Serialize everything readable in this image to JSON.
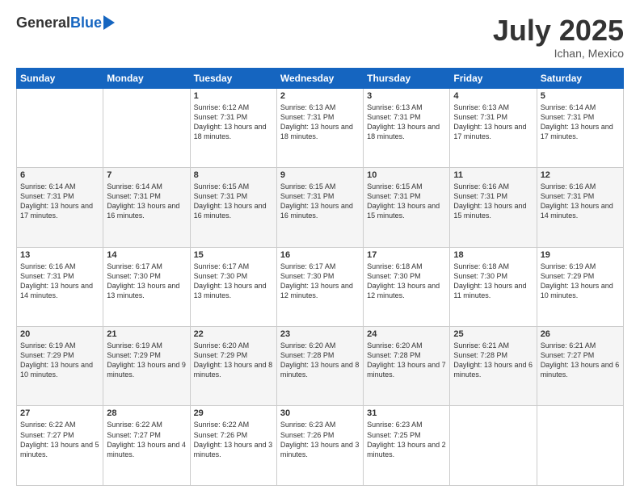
{
  "header": {
    "logo_general": "General",
    "logo_blue": "Blue",
    "title": "July 2025",
    "subtitle": "Ichan, Mexico"
  },
  "days_of_week": [
    "Sunday",
    "Monday",
    "Tuesday",
    "Wednesday",
    "Thursday",
    "Friday",
    "Saturday"
  ],
  "weeks": [
    [
      {
        "day": "",
        "info": ""
      },
      {
        "day": "",
        "info": ""
      },
      {
        "day": "1",
        "info": "Sunrise: 6:12 AM\nSunset: 7:31 PM\nDaylight: 13 hours and 18 minutes."
      },
      {
        "day": "2",
        "info": "Sunrise: 6:13 AM\nSunset: 7:31 PM\nDaylight: 13 hours and 18 minutes."
      },
      {
        "day": "3",
        "info": "Sunrise: 6:13 AM\nSunset: 7:31 PM\nDaylight: 13 hours and 18 minutes."
      },
      {
        "day": "4",
        "info": "Sunrise: 6:13 AM\nSunset: 7:31 PM\nDaylight: 13 hours and 17 minutes."
      },
      {
        "day": "5",
        "info": "Sunrise: 6:14 AM\nSunset: 7:31 PM\nDaylight: 13 hours and 17 minutes."
      }
    ],
    [
      {
        "day": "6",
        "info": "Sunrise: 6:14 AM\nSunset: 7:31 PM\nDaylight: 13 hours and 17 minutes."
      },
      {
        "day": "7",
        "info": "Sunrise: 6:14 AM\nSunset: 7:31 PM\nDaylight: 13 hours and 16 minutes."
      },
      {
        "day": "8",
        "info": "Sunrise: 6:15 AM\nSunset: 7:31 PM\nDaylight: 13 hours and 16 minutes."
      },
      {
        "day": "9",
        "info": "Sunrise: 6:15 AM\nSunset: 7:31 PM\nDaylight: 13 hours and 16 minutes."
      },
      {
        "day": "10",
        "info": "Sunrise: 6:15 AM\nSunset: 7:31 PM\nDaylight: 13 hours and 15 minutes."
      },
      {
        "day": "11",
        "info": "Sunrise: 6:16 AM\nSunset: 7:31 PM\nDaylight: 13 hours and 15 minutes."
      },
      {
        "day": "12",
        "info": "Sunrise: 6:16 AM\nSunset: 7:31 PM\nDaylight: 13 hours and 14 minutes."
      }
    ],
    [
      {
        "day": "13",
        "info": "Sunrise: 6:16 AM\nSunset: 7:31 PM\nDaylight: 13 hours and 14 minutes."
      },
      {
        "day": "14",
        "info": "Sunrise: 6:17 AM\nSunset: 7:30 PM\nDaylight: 13 hours and 13 minutes."
      },
      {
        "day": "15",
        "info": "Sunrise: 6:17 AM\nSunset: 7:30 PM\nDaylight: 13 hours and 13 minutes."
      },
      {
        "day": "16",
        "info": "Sunrise: 6:17 AM\nSunset: 7:30 PM\nDaylight: 13 hours and 12 minutes."
      },
      {
        "day": "17",
        "info": "Sunrise: 6:18 AM\nSunset: 7:30 PM\nDaylight: 13 hours and 12 minutes."
      },
      {
        "day": "18",
        "info": "Sunrise: 6:18 AM\nSunset: 7:30 PM\nDaylight: 13 hours and 11 minutes."
      },
      {
        "day": "19",
        "info": "Sunrise: 6:19 AM\nSunset: 7:29 PM\nDaylight: 13 hours and 10 minutes."
      }
    ],
    [
      {
        "day": "20",
        "info": "Sunrise: 6:19 AM\nSunset: 7:29 PM\nDaylight: 13 hours and 10 minutes."
      },
      {
        "day": "21",
        "info": "Sunrise: 6:19 AM\nSunset: 7:29 PM\nDaylight: 13 hours and 9 minutes."
      },
      {
        "day": "22",
        "info": "Sunrise: 6:20 AM\nSunset: 7:29 PM\nDaylight: 13 hours and 8 minutes."
      },
      {
        "day": "23",
        "info": "Sunrise: 6:20 AM\nSunset: 7:28 PM\nDaylight: 13 hours and 8 minutes."
      },
      {
        "day": "24",
        "info": "Sunrise: 6:20 AM\nSunset: 7:28 PM\nDaylight: 13 hours and 7 minutes."
      },
      {
        "day": "25",
        "info": "Sunrise: 6:21 AM\nSunset: 7:28 PM\nDaylight: 13 hours and 6 minutes."
      },
      {
        "day": "26",
        "info": "Sunrise: 6:21 AM\nSunset: 7:27 PM\nDaylight: 13 hours and 6 minutes."
      }
    ],
    [
      {
        "day": "27",
        "info": "Sunrise: 6:22 AM\nSunset: 7:27 PM\nDaylight: 13 hours and 5 minutes."
      },
      {
        "day": "28",
        "info": "Sunrise: 6:22 AM\nSunset: 7:27 PM\nDaylight: 13 hours and 4 minutes."
      },
      {
        "day": "29",
        "info": "Sunrise: 6:22 AM\nSunset: 7:26 PM\nDaylight: 13 hours and 3 minutes."
      },
      {
        "day": "30",
        "info": "Sunrise: 6:23 AM\nSunset: 7:26 PM\nDaylight: 13 hours and 3 minutes."
      },
      {
        "day": "31",
        "info": "Sunrise: 6:23 AM\nSunset: 7:25 PM\nDaylight: 13 hours and 2 minutes."
      },
      {
        "day": "",
        "info": ""
      },
      {
        "day": "",
        "info": ""
      }
    ]
  ]
}
